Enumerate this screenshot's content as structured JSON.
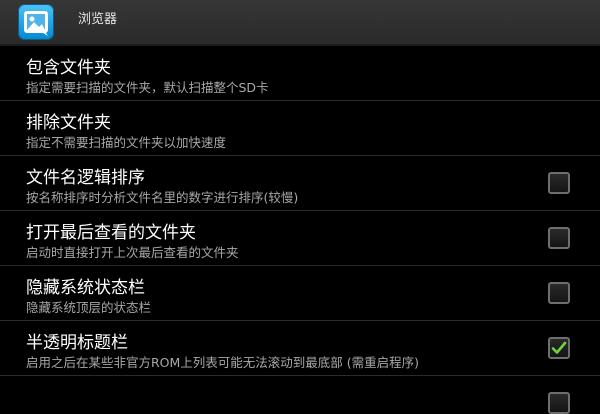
{
  "app": {
    "title": "浏览器",
    "icon": "gallery-app-icon"
  },
  "settings": [
    {
      "title": "包含文件夹",
      "subtitle": "指定需要扫描的文件夹，默认扫描整个SD卡",
      "checkbox": null
    },
    {
      "title": "排除文件夹",
      "subtitle": "指定不需要扫描的文件夹以加快速度",
      "checkbox": null
    },
    {
      "title": "文件名逻辑排序",
      "subtitle": "按名称排序时分析文件名里的数字进行排序(较慢)",
      "checkbox": false
    },
    {
      "title": "打开最后查看的文件夹",
      "subtitle": "启动时直接打开上次最后查看的文件夹",
      "checkbox": false
    },
    {
      "title": "隐藏系统状态栏",
      "subtitle": "隐藏系统顶层的状态栏",
      "checkbox": false
    },
    {
      "title": "半透明标题栏",
      "subtitle": "启用之后在某些非官方ROM上列表可能无法滚动到最底部 (需重启程序)",
      "checkbox": true
    }
  ],
  "colors": {
    "checkmark": "#6fd43c",
    "background": "#000000"
  }
}
